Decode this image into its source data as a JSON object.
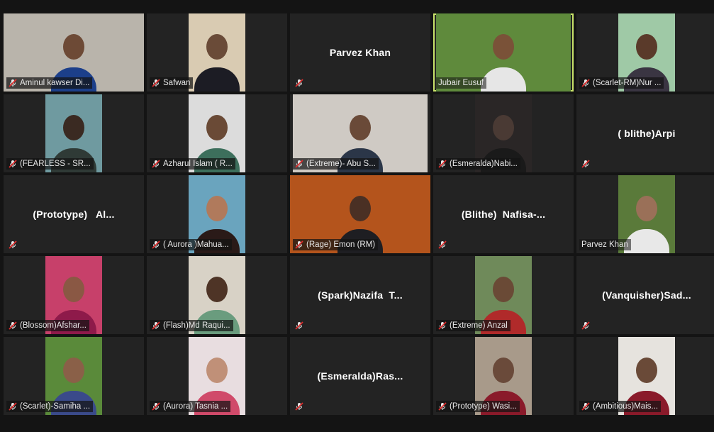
{
  "meeting": {
    "participants": [
      {
        "name": "Aminul kawser Di...",
        "muted": true,
        "video": true,
        "bg": "#b9b4ab",
        "skin": "#6d4a36",
        "shirt": "#1c3f8a",
        "wide": "full"
      },
      {
        "name": "Safwan",
        "muted": true,
        "video": true,
        "bg": "#d9cbb2",
        "skin": "#6a4b38",
        "shirt": "#1c1c24"
      },
      {
        "name": "Parvez Khan",
        "muted": true,
        "video": false
      },
      {
        "name": "Jubair Eusuf",
        "muted": false,
        "video": true,
        "active": true,
        "bg": "#5f8a3c",
        "skin": "#7a5238",
        "shirt": "#e6e6e6",
        "wide": "w190"
      },
      {
        "name": "(Scarlet-RM)Nur ...",
        "muted": true,
        "video": true,
        "bg": "#9fc9a6",
        "skin": "#5a3a2a",
        "shirt": "#3a3542"
      },
      {
        "name": "(FEARLESS - SR...",
        "muted": true,
        "video": true,
        "bg": "#6f9aa0",
        "skin": "#3a2a22",
        "shirt": "#2f3a36"
      },
      {
        "name": "Azharul Islam ( R...",
        "muted": true,
        "video": true,
        "bg": "#dcdcdc",
        "skin": "#6a4a36",
        "shirt": "#3d6f5c"
      },
      {
        "name": "(Extreme)- Abu S...",
        "muted": true,
        "video": true,
        "bg": "#cfcac4",
        "skin": "#6a4a38",
        "shirt": "#2b3648",
        "wide": "w190"
      },
      {
        "name": "(Esmeralda)Nabi...",
        "muted": true,
        "video": true,
        "bg": "#2a2626",
        "skin": "#4a3a34",
        "shirt": "#1a1a1a"
      },
      {
        "name": "( blithe)Arpi",
        "muted": true,
        "video": false
      },
      {
        "name": "(Prototype)   Al...",
        "muted": true,
        "video": false
      },
      {
        "name": "( Aurora )Mahua...",
        "muted": true,
        "video": true,
        "bg": "#6aa4be",
        "skin": "#b07a5c",
        "shirt": "#2a1a18"
      },
      {
        "name": "(Rage) Emon (RM)",
        "muted": true,
        "video": true,
        "bg": "#b4541c",
        "skin": "#4a3024",
        "shirt": "#1e1e22",
        "wide": "full"
      },
      {
        "name": "(Blithe)  Nafisa-...",
        "muted": true,
        "video": false
      },
      {
        "name": "Parvez Khan",
        "muted": false,
        "video": true,
        "bg": "#5a7a3a",
        "skin": "#9a7058",
        "shirt": "#e8e8e8"
      },
      {
        "name": "(Blossom)Afshar...",
        "muted": true,
        "video": true,
        "bg": "#c7406a",
        "skin": "#8a5844",
        "shirt": "#8e1a4a"
      },
      {
        "name": "(Flash)Md Raqui...",
        "muted": true,
        "video": true,
        "bg": "#d8d2c6",
        "skin": "#4e3426",
        "shirt": "#6a9c7e"
      },
      {
        "name": "(Spark)Nazifa  T...",
        "muted": true,
        "video": false
      },
      {
        "name": "(Extreme) Anzal",
        "muted": true,
        "video": true,
        "bg": "#6f8a5a",
        "skin": "#6a4a36",
        "shirt": "#b02a2a"
      },
      {
        "name": "(Vanquisher)Sad...",
        "muted": true,
        "video": false
      },
      {
        "name": "(Scarlet)-Samiha ...",
        "muted": true,
        "video": true,
        "bg": "#5a8a3a",
        "skin": "#8a6048",
        "shirt": "#3a4a8a"
      },
      {
        "name": "(Aurora) Tasnia ...",
        "muted": true,
        "video": true,
        "bg": "#e8dde0",
        "skin": "#c09078",
        "shirt": "#d04a6a"
      },
      {
        "name": "(Esmeralda)Ras...",
        "muted": true,
        "video": false
      },
      {
        "name": "(Prototype) Wasi...",
        "muted": true,
        "video": true,
        "bg": "#a89a8a",
        "skin": "#6a4a3a",
        "shirt": "#8a1a2a"
      },
      {
        "name": "(Ambitious)Mais...",
        "muted": true,
        "video": true,
        "bg": "#e6e3de",
        "skin": "#6a4a38",
        "shirt": "#8a1a2a"
      }
    ]
  },
  "colors": {
    "tile_bg": "#232323",
    "page_bg": "#141414",
    "active_speaker": "#c9e26b",
    "muted_icon": "#e02d2d"
  },
  "icons": {
    "muted": "mic-muted-icon"
  }
}
